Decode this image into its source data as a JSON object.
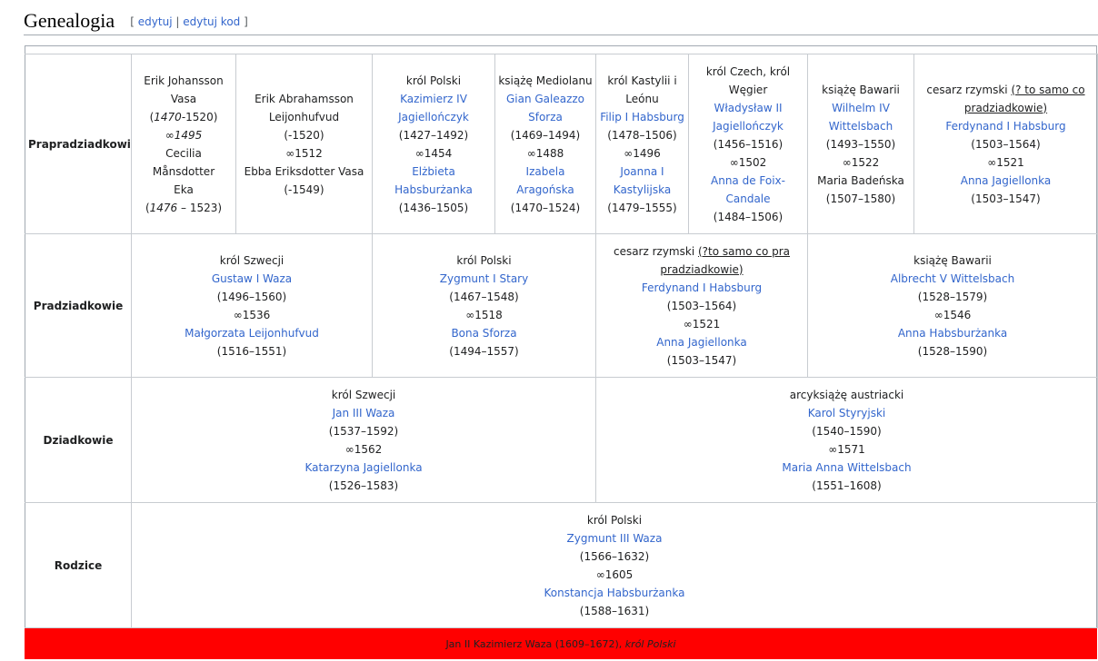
{
  "section": {
    "title": "Genealogia",
    "edit_open": "[",
    "edit_label": "edytuj",
    "edit_sep": "|",
    "edit_code_label": "edytuj kod",
    "edit_close": "]"
  },
  "rows": {
    "prapradziadkowie": "Prapradziadkowie",
    "pradziadkowie": "Pradziadkowie",
    "dziadkowie": "Dziadkowie",
    "rodzice": "Rodzice"
  },
  "gg": [
    {
      "l1": "Erik Johansson",
      "l2": "Vasa",
      "l3a": "1470",
      "l3b": "-1520)",
      "l4": "∞1495",
      "l5": "Cecilia Månsdotter",
      "l6": "Eka",
      "l7a": "1476",
      "l7b": " – 1523)"
    },
    {
      "l1": "Erik Abrahamsson",
      "l2": "Leijonhufvud",
      "l3": "(-1520)",
      "l4": "∞1512",
      "l5": "Ebba Eriksdotter Vasa",
      "l6": "(-1549)"
    },
    {
      "title": "król Polski",
      "l1": "Kazimierz IV",
      "l2": "Jagiellończyk",
      "l3": "(1427–1492)",
      "l4": "∞1454",
      "l5": "Elżbieta",
      "l6": "Habsburżanka",
      "l7": "(1436–1505)"
    },
    {
      "title": "książę Mediolanu",
      "l1": "Gian Galeazzo",
      "l2": "Sforza",
      "l3": "(1469–1494)",
      "l4": "∞1488",
      "l5": "Izabela",
      "l6": "Aragońska",
      "l7": "(1470–1524)"
    },
    {
      "title1": "król Kastylii i",
      "title2": "Leónu",
      "l1": "Filip I Habsburg",
      "l2": "(1478–1506)",
      "l3": "∞1496",
      "l4": "Joanna I",
      "l5": "Kastylijska",
      "l6": "(1479–1555)"
    },
    {
      "title1": "król Czech, król",
      "title2": "Węgier",
      "l1": "Władysław II",
      "l2": "Jagiellończyk",
      "l3": "(1456–1516)",
      "l4": "∞1502",
      "l5": "Anna de Foix-",
      "l6": "Candale",
      "l7": "(1484–1506)"
    },
    {
      "title": "książę Bawarii",
      "l1": "Wilhelm IV",
      "l2": "Wittelsbach",
      "l3": "(1493–1550)",
      "l4": "∞1522",
      "l5": "Maria Badeńska",
      "l6": "(1507–1580)"
    },
    {
      "title": "cesarz rzymski ",
      "note1": "(? to samo co",
      "note2": "pradziadkowie)",
      "l1": "Ferdynand I Habsburg",
      "l2": "(1503–1564)",
      "l3": "∞1521",
      "l4": "Anna Jagiellonka",
      "l5": "(1503–1547)"
    }
  ],
  "g": [
    {
      "title": "król Szwecji",
      "l1": "Gustaw I Waza",
      "l2": "(1496–1560)",
      "l3": "∞1536",
      "l4": "Małgorzata Leijonhufvud",
      "l5": "(1516–1551)"
    },
    {
      "title": "król Polski",
      "l1": "Zygmunt I Stary",
      "l2": "(1467–1548)",
      "l3": "∞1518",
      "l4": "Bona Sforza",
      "l5": "(1494–1557)"
    },
    {
      "title": "cesarz rzymski ",
      "note1": "(?to samo co pra",
      "note2": "pradziadkowie)",
      "l1": "Ferdynand I Habsburg",
      "l2": "(1503–1564)",
      "l3": "∞1521",
      "l4": "Anna Jagiellonka",
      "l5": "(1503–1547)"
    },
    {
      "title": "książę Bawarii",
      "l1": "Albrecht V Wittelsbach",
      "l2": "(1528–1579)",
      "l3": "∞1546",
      "l4": "Anna Habsburżanka",
      "l5": "(1528–1590)"
    }
  ],
  "d": [
    {
      "title": "król Szwecji",
      "l1": "Jan III Waza",
      "l2": "(1537–1592)",
      "l3": "∞1562",
      "l4": "Katarzyna Jagiellonka",
      "l5": "(1526–1583)"
    },
    {
      "title": "arcyksiążę austriacki",
      "l1": "Karol Styryjski",
      "l2": "(1540–1590)",
      "l3": "∞1571",
      "l4": "Maria Anna Wittelsbach",
      "l5": "(1551–1608)"
    }
  ],
  "r": {
    "title": "król Polski",
    "l1": "Zygmunt III Waza",
    "l2": "(1566–1632)",
    "l3": "∞1605",
    "l4": "Konstancja Habsburżanka",
    "l5": "(1588–1631)"
  },
  "child": {
    "name": "Jan II Kazimierz Waza (1609–1672), ",
    "title": "król Polski"
  },
  "colors": {
    "link": "#3366cc",
    "child_bg": "#ff0000",
    "border": "#c8ccd1"
  }
}
